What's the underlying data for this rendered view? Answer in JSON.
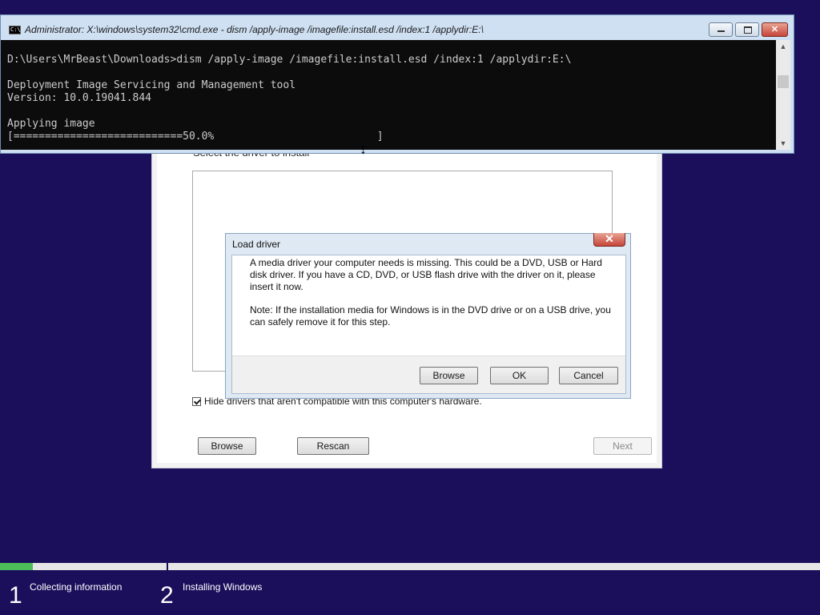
{
  "cmd_window": {
    "title": "Administrator: X:\\windows\\system32\\cmd.exe - dism  /apply-image /imagefile:install.esd /index:1 /applydir:E:\\",
    "lines": [
      "D:\\Users\\MrBeast\\Downloads>dism /apply-image /imagefile:install.esd /index:1 /applydir:E:\\",
      "",
      "Deployment Image Servicing and Management tool",
      "Version: 10.0.19041.844",
      "",
      "Applying image",
      "[===========================50.0%                          ]"
    ],
    "icon": "console-icon"
  },
  "setup_window": {
    "heading": "Select the driver to install",
    "hide_incompatible_label": "Hide drivers that aren't compatible with this computer's hardware.",
    "hide_incompatible_checked": true,
    "browse_label": "Browse",
    "rescan_label": "Rescan",
    "next_label": "Next"
  },
  "load_driver_dialog": {
    "title": "Load driver",
    "message": "A media driver your computer needs is missing. This could be a DVD, USB or Hard disk driver. If you have a CD, DVD, or USB flash drive with the driver on it, please insert it now.",
    "note": "Note: If the installation media for Windows is in the DVD drive or on a USB drive, you can safely remove it for this step.",
    "browse_label": "Browse",
    "ok_label": "OK",
    "cancel_label": "Cancel"
  },
  "progress": {
    "fraction": 0.04,
    "steps": [
      {
        "number": "1",
        "label": "Collecting information"
      },
      {
        "number": "2",
        "label": "Installing Windows"
      }
    ]
  },
  "colors": {
    "background": "#1b0f5c",
    "progress_fill": "#4dbd5a",
    "console_bg": "#0c0c0c",
    "console_text": "#cccccc"
  }
}
